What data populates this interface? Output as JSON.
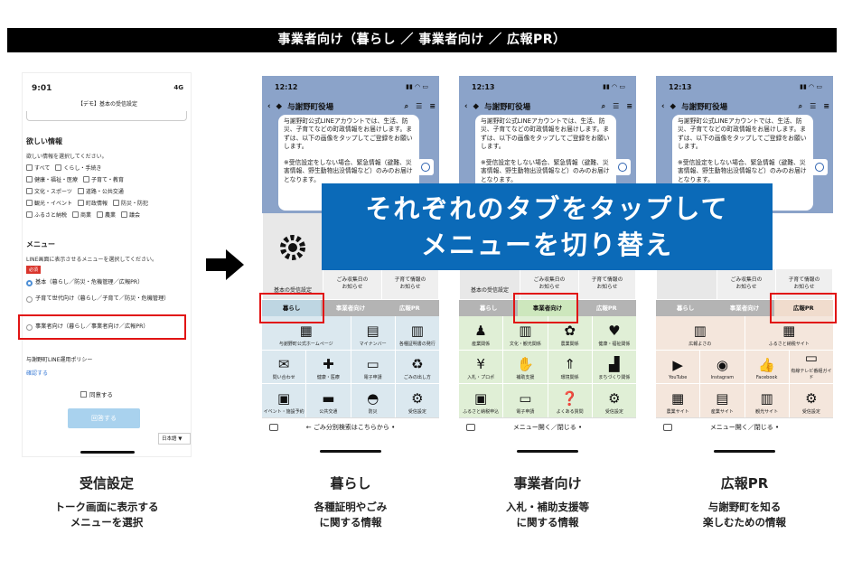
{
  "header": {
    "title": "事業者向け（暮らし ／ 事業者向け ／ 広報PR）"
  },
  "overlay": {
    "line1": "それぞれのタブをタップして",
    "line2": "メニューを切り替え"
  },
  "settings_phone": {
    "time": "9:01",
    "network": "4G",
    "title": "【デモ】基本の受信設定",
    "interest_heading": "欲しい情報",
    "interest_note": "欲しい情報を選択してください。",
    "checkbox_rows": [
      [
        "すべて",
        "くらし・手続き"
      ],
      [
        "健康・福祉・医療",
        "子育て・教育"
      ],
      [
        "文化・スポーツ",
        "道路・公共交通"
      ],
      [
        "観光・イベント",
        "町政情報",
        "防災・防犯"
      ],
      [
        "ふるさと納税",
        "商業",
        "農業",
        "議会"
      ]
    ],
    "menu_heading": "メニュー",
    "menu_note": "LINE画面に表示させるメニューを選択してください。",
    "required": "必須",
    "options": [
      "基本（暮らし／防災・危機管理／広報PR）",
      "子育て世代向け（暮らし／子育て／防災・危機管理）",
      "事業者向け（暮らし／事業者向け／広報PR）"
    ],
    "policy": "与謝野町LINE運用ポリシー",
    "confirm": "確認する",
    "agree": "同意する",
    "answer": "回答する",
    "language": "日本語 ▼"
  },
  "chat": {
    "account": "与謝野町役場",
    "message1": "与謝野町公式LINEアカウントでは、生活、防災、子育てなどの町政情報をお届けします。まずは、以下の画像をタップしてご登録をお願いします。",
    "message2": "※受信設定をしない場合、緊急情報（避難、災害情報、野生動物出没情報など）のみのお届けとなります。"
  },
  "phones": [
    {
      "time": "12:12",
      "big_label": "基本の受信設定",
      "small": [
        "ごみ収集日の\nお知らせ",
        "子育て情報の\nお知らせ"
      ],
      "tabs": [
        "暮らし",
        "事業者向け",
        "広報PR"
      ],
      "active_tab": 0,
      "grid": [
        {
          "label": "与謝野町公式ホームページ",
          "icon": "▦",
          "span": 2
        },
        {
          "label": "マイナンバー",
          "icon": "▤"
        },
        {
          "label": "各種証明書の発行",
          "icon": "▥"
        },
        {
          "label": "問い合わせ",
          "icon": "✉"
        },
        {
          "label": "健康・医療",
          "icon": "✚"
        },
        {
          "label": "電子申請",
          "icon": "▭"
        },
        {
          "label": "ごみの出し方",
          "icon": "♻"
        },
        {
          "label": "イベント・施設予約",
          "icon": "▣"
        },
        {
          "label": "公共交通",
          "icon": "▬"
        },
        {
          "label": "防災",
          "icon": "◓"
        },
        {
          "label": "受信設定",
          "icon": "⚙"
        }
      ],
      "bottom": "← ごみ分別検索はこちらから •"
    },
    {
      "time": "12:13",
      "big_label": "基本の受信設定",
      "small": [
        "ごみ収集日の\nお知らせ",
        "子育て情報の\nお知らせ"
      ],
      "tabs": [
        "暮らし",
        "事業者向け",
        "広報PR"
      ],
      "active_tab": 1,
      "grid": [
        {
          "label": "産業関係",
          "icon": "♟"
        },
        {
          "label": "文化・観光関係",
          "icon": "▥"
        },
        {
          "label": "農業関係",
          "icon": "✿"
        },
        {
          "label": "健康・福祉関係",
          "icon": "♥"
        },
        {
          "label": "入札・プロポ",
          "icon": "¥"
        },
        {
          "label": "補助支援",
          "icon": "✋"
        },
        {
          "label": "環境関係",
          "icon": "⇑"
        },
        {
          "label": "まちづくり関係",
          "icon": "▟"
        },
        {
          "label": "ふるさと納税申込",
          "icon": "▣"
        },
        {
          "label": "電子申請",
          "icon": "▭"
        },
        {
          "label": "よくある質問",
          "icon": "❓"
        },
        {
          "label": "受信設定",
          "icon": "⚙"
        }
      ],
      "bottom": "メニュー開く／閉じる •"
    },
    {
      "time": "12:13",
      "big_label": "",
      "small": [
        "ごみ収集日の\nお知らせ",
        "子育て情報の\nお知らせ"
      ],
      "tabs": [
        "暮らし",
        "事業者向け",
        "広報PR"
      ],
      "active_tab": 2,
      "grid": [
        {
          "label": "広報よさの",
          "icon": "▥",
          "span": 2
        },
        {
          "label": "ふるさと納税サイト",
          "icon": "▦",
          "span": 2
        },
        {
          "label": "YouTube",
          "icon": "▶"
        },
        {
          "label": "Instagram",
          "icon": "◉"
        },
        {
          "label": "Facebook",
          "icon": "👍"
        },
        {
          "label": "有線テレビ番組ガイド",
          "icon": "▭"
        },
        {
          "label": "農業サイト",
          "icon": "▦"
        },
        {
          "label": "産業サイト",
          "icon": "▤"
        },
        {
          "label": "観光サイト",
          "icon": "▥"
        },
        {
          "label": "受信設定",
          "icon": "⚙"
        }
      ],
      "bottom": "メニュー開く／閉じる •"
    }
  ],
  "captions": [
    {
      "title": "受信設定",
      "desc1": "トーク画面に表示する",
      "desc2": "メニューを選択"
    },
    {
      "title": "暮らし",
      "desc1": "各種証明やごみ",
      "desc2": "に関する情報"
    },
    {
      "title": "事業者向け",
      "desc1": "入札・補助支援等",
      "desc2": "に関する情報"
    },
    {
      "title": "広報PR",
      "desc1": "与謝野町を知る",
      "desc2": "楽しむための情報"
    }
  ],
  "colors": {
    "tab_kurashi": "#bed6e2",
    "tab_jigyo": "#cde7bd",
    "tab_pr": "#f0dccd",
    "grid_kurashi": "#dbe8ef",
    "grid_jigyo": "#e0efd6",
    "grid_pr": "#f4e6dc",
    "highlight": "#e11414",
    "overlay": "#0b6ab8"
  }
}
